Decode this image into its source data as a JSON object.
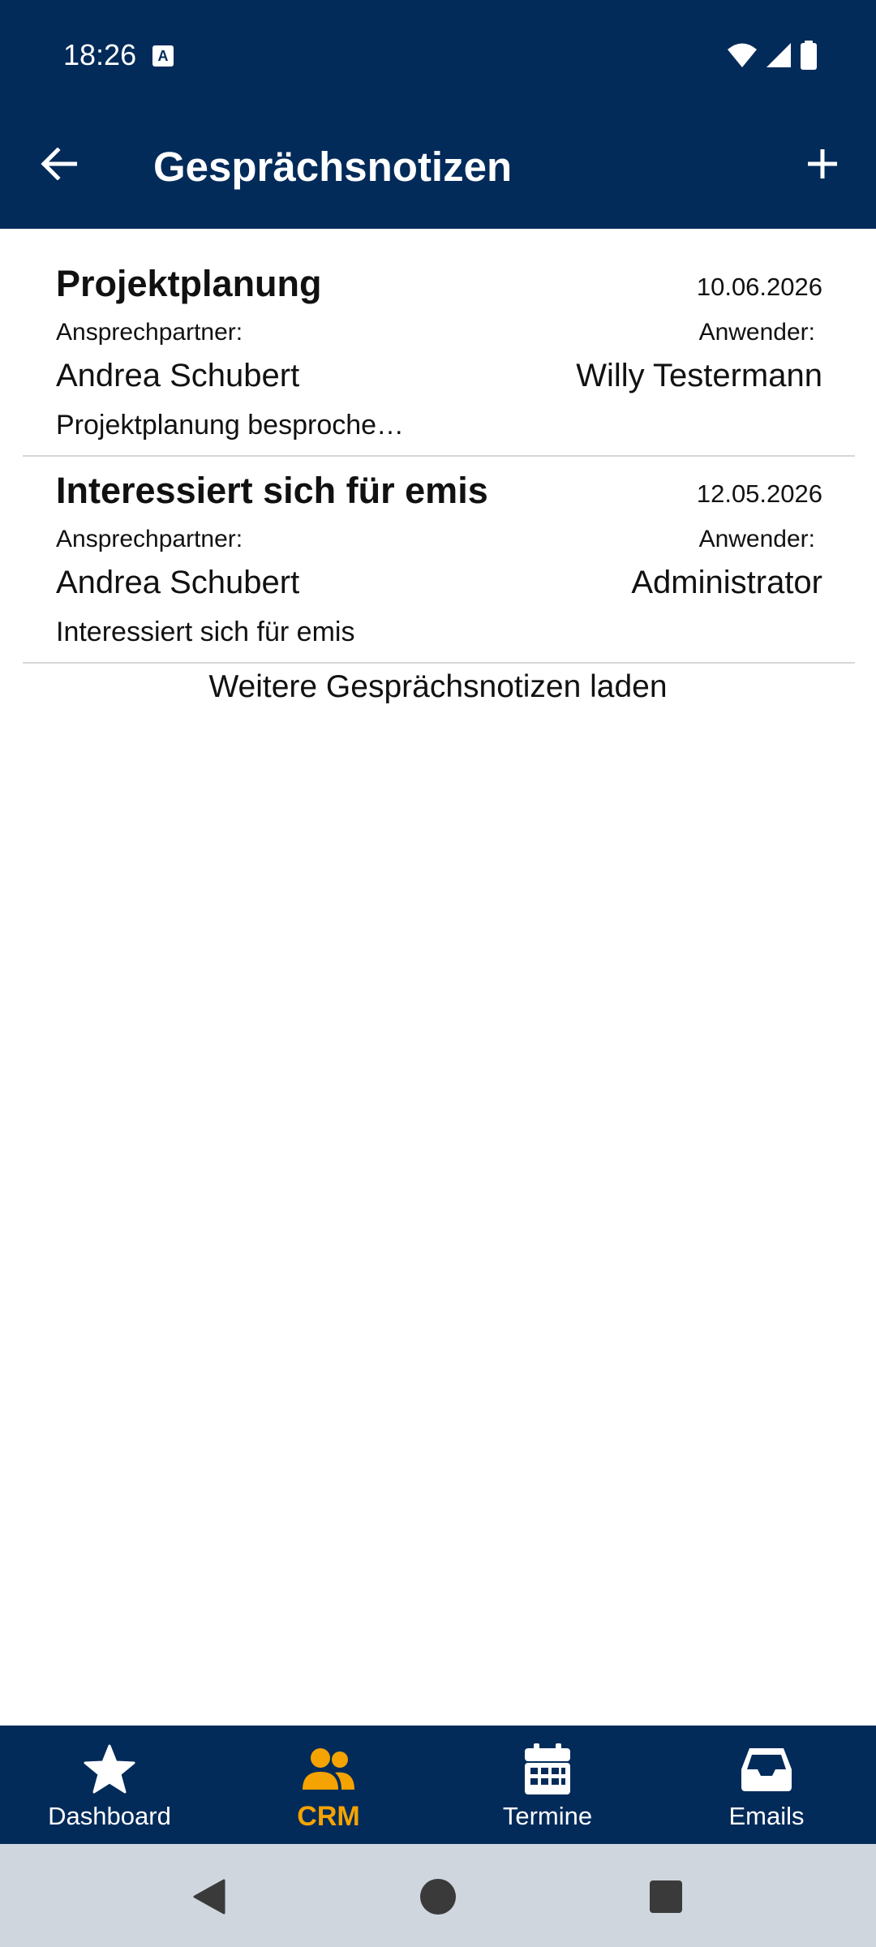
{
  "status_bar": {
    "time": "18:26",
    "keyboard_icon": "A",
    "icons": [
      "wifi-icon",
      "signal-icon",
      "battery-icon"
    ]
  },
  "app_bar": {
    "title": "Gesprächsnotizen",
    "back_icon": "arrow-left-icon",
    "add_icon": "plus-icon"
  },
  "notes": [
    {
      "title": "Projektplanung",
      "date": "10.06.2026",
      "contact_label": "Ansprechpartner:",
      "contact": "Andrea Schubert",
      "user_label": "Anwender:",
      "user": "Willy Testermann",
      "preview": "Projektplanung besproche…"
    },
    {
      "title": "Interessiert sich für emis",
      "date": "12.05.2026",
      "contact_label": "Ansprechpartner:",
      "contact": "Andrea Schubert",
      "user_label": "Anwender:",
      "user": "Administrator",
      "preview": "Interessiert sich für emis"
    }
  ],
  "load_more": "Weitere Gesprächsnotizen laden",
  "bottom_nav": {
    "active": "CRM",
    "items": [
      {
        "label": "Dashboard",
        "icon": "star-icon"
      },
      {
        "label": "CRM",
        "icon": "people-icon"
      },
      {
        "label": "Termine",
        "icon": "calendar-icon"
      },
      {
        "label": "Emails",
        "icon": "inbox-icon"
      }
    ]
  },
  "colors": {
    "primary": "#022b5a",
    "accent": "#f5a300",
    "divider": "#d6d6d6",
    "system_nav": "#cfd6de",
    "system_nav_icon": "#3a3a3a"
  }
}
